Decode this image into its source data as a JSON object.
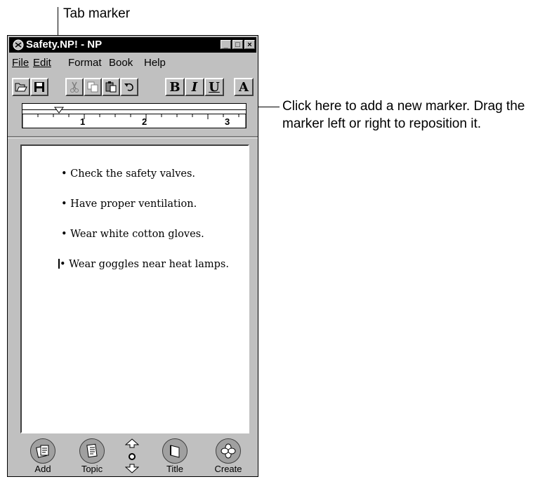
{
  "callouts": {
    "tab_marker": "Tab marker",
    "click_line1": "Click here to add a new marker. Drag the",
    "click_line2": "marker left or right to reposition it."
  },
  "window": {
    "title": "Safety.NP! - NP",
    "menu": [
      "File",
      "Edit",
      "Format",
      "Book",
      "Help"
    ]
  },
  "toolbar": {
    "buttons": [
      "open-icon",
      "save-icon",
      "cut-icon",
      "copy-icon",
      "paste-icon",
      "undo-icon"
    ],
    "format": {
      "bold": "B",
      "italic": "I",
      "underline": "U",
      "font": "A"
    }
  },
  "ruler": {
    "labels": [
      "1",
      "2",
      "3"
    ]
  },
  "document": {
    "bullets": [
      "Check the safety valves.",
      "Have proper ventilation.",
      "Wear white cotton gloves.",
      "Wear goggles near heat lamps."
    ]
  },
  "bottom": {
    "add": "Add",
    "topic": "Topic",
    "title": "Title",
    "create": "Create"
  }
}
